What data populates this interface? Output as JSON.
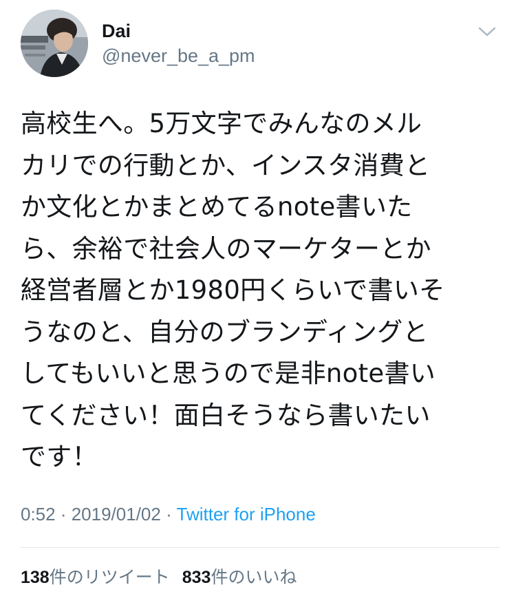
{
  "user": {
    "display_name": "Dai",
    "handle": "@never_be_a_pm",
    "avatar_icon": "profile-photo",
    "menu_icon": "chevron-down-icon"
  },
  "tweet": {
    "lines": [
      "高校生へ。5万文字でみんなのメル",
      "カリでの行動とか、インスタ消費と",
      "か文化とかまとめてるnote書いた",
      "ら、余裕で社会人のマーケターとか",
      "経営者層とか1980円くらいで書いそ",
      "うなのと、自分のブランディングと",
      "してもいいと思うので是非note書い",
      "てください！面白そうなら書いたい",
      "です！"
    ]
  },
  "meta": {
    "time": "0:52",
    "separator": " · ",
    "date": "2019/01/02",
    "source": "Twitter for iPhone"
  },
  "stats": {
    "retweets_count": "138",
    "retweets_label": "件のリツイート",
    "likes_count": "833",
    "likes_label": "件のいいね"
  },
  "colors": {
    "text": "#14171a",
    "secondary": "#657786",
    "link": "#1da1f2",
    "divider": "#e1e8ed"
  }
}
